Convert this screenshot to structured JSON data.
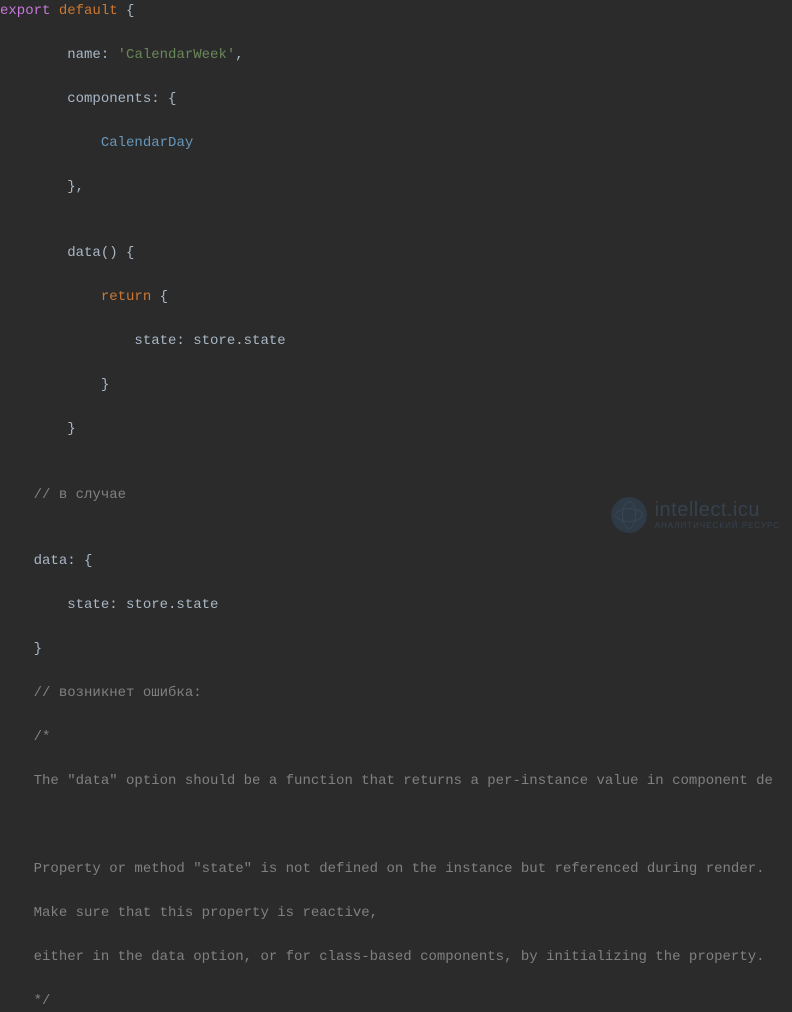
{
  "code": {
    "l1_export": "export",
    "l1_default": "default",
    "l1_brace": " {",
    "l2_prop": "name:",
    "l2_val": "'CalendarWeek'",
    "l2_comma": ",",
    "l3_prop": "components:",
    "l3_brace": " {",
    "l4_comp": "CalendarDay",
    "l5_close": "},",
    "l6_empty": "",
    "l7_data": "data()",
    "l7_brace": " {",
    "l8_return": "return",
    "l8_brace": " {",
    "l9_state": "state: store.state",
    "l10_close": "}",
    "l11_close": "}",
    "l12_empty": "",
    "l13_comment": "// в случае",
    "l14_empty": "",
    "l15_data": "data:",
    "l15_brace": " {",
    "l16_state": "state: store.state",
    "l17_close": "}",
    "l18_comment": "// возникнет ошибка:",
    "l19_comment": "/*",
    "l20_comment": "The \"data\" option should be a function that returns a per-instance value in component de",
    "l21_empty": "",
    "l22_comment": "Property or method \"state\" is not defined on the instance but referenced during render.",
    "l23_comment": "Make sure that this property is reactive,",
    "l24_comment": "either in the data option, or for class-based components, by initializing the property.",
    "l25_comment": "*/"
  },
  "watermark": {
    "main": "intellect.icu",
    "sub": "АНАЛИТИЧЕСКИЙ РЕСУРС"
  }
}
